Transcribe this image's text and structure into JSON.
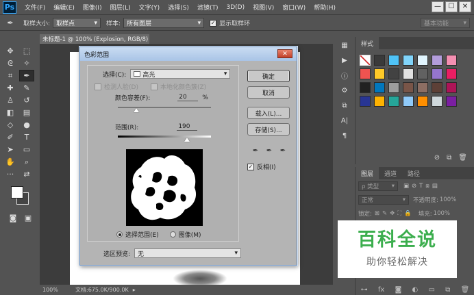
{
  "app": {
    "logo": "Ps"
  },
  "menu": [
    "文件(F)",
    "编辑(E)",
    "图像(I)",
    "图层(L)",
    "文字(Y)",
    "选择(S)",
    "滤镜(T)",
    "3D(D)",
    "视图(V)",
    "窗口(W)",
    "帮助(H)"
  ],
  "window_controls": {
    "minimize": "—",
    "restore": "☐",
    "close": "✕"
  },
  "options_bar": {
    "sample_size_label": "取样大小:",
    "sample_size_value": "取样点",
    "sample_label": "样本:",
    "sample_value": "所有图层",
    "show_ring_label": "显示取样环",
    "show_ring_checked": true,
    "workspace": "基本功能"
  },
  "document": {
    "tab_title": "未标题-1 @ 100% (Explosion, RGB/8) *",
    "tab_close": "×",
    "zoom": "100%",
    "doc_info": "文档:675.0K/900.0K"
  },
  "styles_panel": {
    "tab_label": "样式",
    "swatches": [
      "#ffffff",
      "#3a3a3a",
      "#4fc3f7",
      "#81d4fa",
      "#e1f5fe",
      "#b39ddb",
      "#f48fb1",
      "#ef5350",
      "#ffca28",
      "#424242",
      "#e0e0e0",
      "#616161",
      "#9575cd",
      "#e91e63",
      "#212121",
      "#0277bd",
      "#9e9e9e",
      "#795548",
      "#8d6e63",
      "#5d4037",
      "#ad1457",
      "#283593",
      "#ffb300",
      "#26a69a",
      "#90caf9",
      "#ff8f00",
      "#cfd8dc",
      "#7b1fa2"
    ]
  },
  "layers_panel": {
    "tabs": [
      "图层",
      "通道",
      "路径"
    ],
    "filter_label": "ρ 类型",
    "blend_mode": "正常",
    "opacity_label": "不透明度:",
    "opacity_value": "100%",
    "lock_label": "锁定:",
    "fill_label": "填充:",
    "fill_value": "100%"
  },
  "dialog": {
    "title": "色彩范围",
    "select_label": "选择(C):",
    "select_value": "高光",
    "detect_faces_label": "检测人脸(D)",
    "localized_label": "本地化颜色簇(Z)",
    "fuzziness_label": "颜色容差(F):",
    "fuzziness_value": "20",
    "fuzziness_unit": "%",
    "range_label": "范围(R):",
    "range_value": "190",
    "range_max": 255,
    "fuzziness_max": 100,
    "radio_selection": "选择范围(E)",
    "radio_image": "图像(M)",
    "preview_label": "选区预览:",
    "preview_value": "无",
    "ok": "确定",
    "cancel": "取消",
    "load": "载入(L)...",
    "save": "存储(S)...",
    "invert_label": "反相(I)",
    "invert_checked": true
  },
  "watermark": {
    "title": "百科全说",
    "subtitle": "助你轻松解决"
  }
}
